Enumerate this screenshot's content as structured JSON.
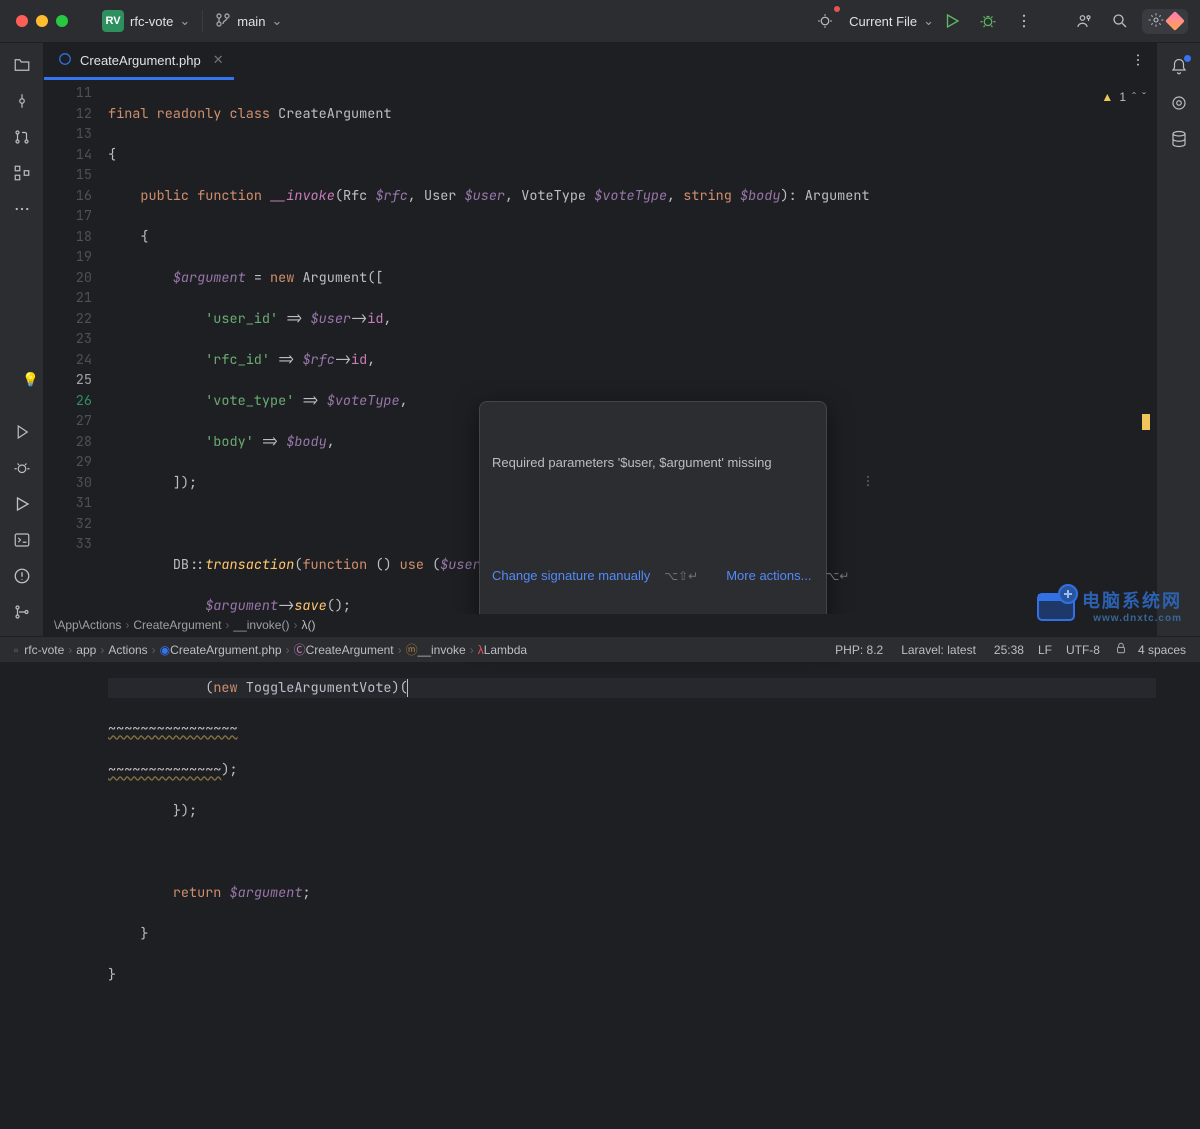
{
  "window": {
    "project_badge": "RV",
    "project_name": "rfc-vote",
    "branch": "main",
    "run_config": "Current File"
  },
  "tab": {
    "filename": "CreateArgument.php"
  },
  "editor_status": {
    "warning_count": "1"
  },
  "code": {
    "lines_start": 11,
    "tokens": {
      "final": "final",
      "readonly": "readonly",
      "class": "class",
      "CreateArgument": "CreateArgument",
      "public": "public",
      "function": "function",
      "invoke": "__invoke",
      "Rfc": "Rfc",
      "rfc": "$rfc",
      "User": "User",
      "user": "$user",
      "VoteType": "VoteType",
      "voteType": "$voteType",
      "string": "string",
      "body": "$body",
      "Argument": "Argument",
      "argument": "$argument",
      "new": "new",
      "user_id": "'user_id'",
      "rfc_id": "'rfc_id'",
      "vote_type": "'vote_type'",
      "body_k": "'body'",
      "id": "id",
      "arrow": "=>",
      "obj": "->",
      "DB": "DB",
      "transaction": "transaction",
      "use": "use",
      "save": "save",
      "return": "return",
      "ToggleArgumentVote": "ToggleArgumentVote",
      "line26_squig": "~~~~~~~~~~~~~~~~",
      "line27_squig": "~~~~~~~~~~~~~~",
      "line27_end": ");",
      "line28": "});",
      "semi": ";"
    }
  },
  "popup": {
    "message": "Required parameters '$user, $argument' missing",
    "action1": "Change signature manually",
    "shortcut1": "⌥⇧↵",
    "action2": "More actions...",
    "shortcut2": "⌥↵"
  },
  "breadcrumbs_top": [
    "\\App\\Actions",
    "CreateArgument",
    "__invoke()",
    "λ()"
  ],
  "statusbar": {
    "path": [
      "rfc-vote",
      "app",
      "Actions",
      "CreateArgument.php",
      "CreateArgument",
      "__invoke",
      "Lambda"
    ],
    "php": "PHP: 8.2",
    "laravel": "Laravel: latest",
    "pos": "25:38",
    "eol": "LF",
    "enc": "UTF-8",
    "indent": "4 spaces"
  },
  "watermark": {
    "cn": "电脑系统网",
    "en": "www.dnxtc.com"
  }
}
